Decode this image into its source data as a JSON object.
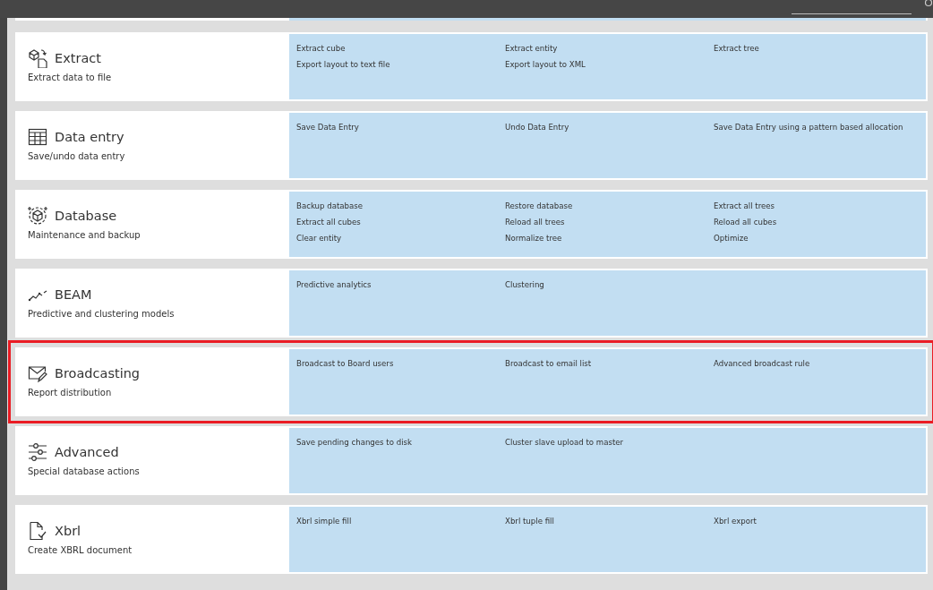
{
  "sections": [
    {
      "title": "Extract",
      "subtitle": "Extract data to file",
      "highlighted": false,
      "actions": [
        "Extract cube",
        "Extract entity",
        "Extract tree",
        "Export layout to text file",
        "Export layout to XML"
      ]
    },
    {
      "title": "Data entry",
      "subtitle": "Save/undo data entry",
      "highlighted": false,
      "actions": [
        "Save Data Entry",
        "Undo Data Entry",
        "Save Data Entry using a pattern based allocation"
      ]
    },
    {
      "title": "Database",
      "subtitle": "Maintenance and backup",
      "highlighted": false,
      "actions": [
        "Backup database",
        "Restore database",
        "Extract all trees",
        "Extract all cubes",
        "Reload all trees",
        "Reload all cubes",
        "Clear entity",
        "Normalize tree",
        "Optimize"
      ]
    },
    {
      "title": "BEAM",
      "subtitle": "Predictive and clustering models",
      "highlighted": false,
      "actions": [
        "Predictive analytics",
        "Clustering"
      ]
    },
    {
      "title": "Broadcasting",
      "subtitle": "Report distribution",
      "highlighted": true,
      "actions": [
        "Broadcast to Board users",
        "Broadcast to email list",
        "Advanced broadcast rule"
      ]
    },
    {
      "title": "Advanced",
      "subtitle": "Special database actions",
      "highlighted": false,
      "actions": [
        "Save pending changes to disk",
        "Cluster slave upload to master"
      ]
    },
    {
      "title": "Xbrl",
      "subtitle": "Create XBRL document",
      "highlighted": false,
      "actions": [
        "Xbrl simple fill",
        "Xbrl tuple fill",
        "Xbrl export"
      ]
    }
  ]
}
